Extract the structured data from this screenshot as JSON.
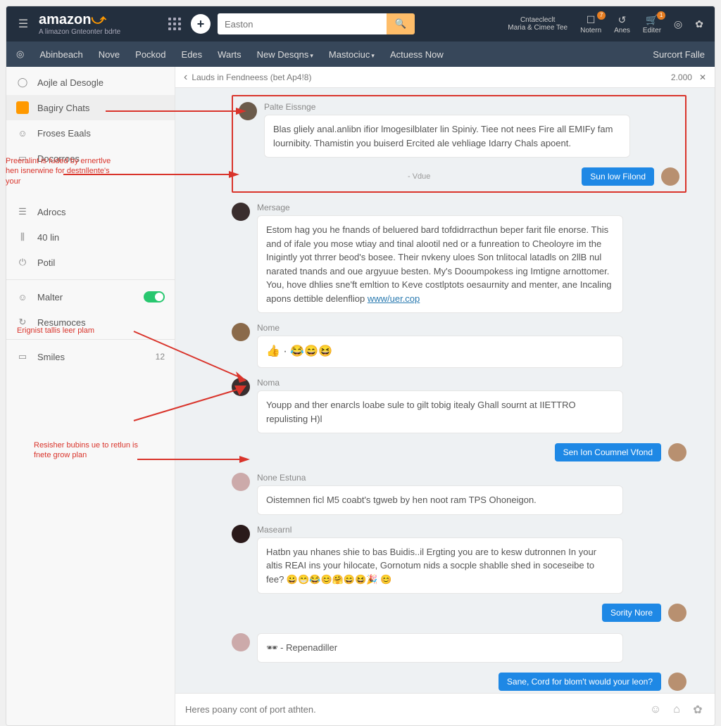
{
  "brand": {
    "name": "amazon",
    "tagline": "A limazon Gnteonter bdrte"
  },
  "search": {
    "placeholder": "Easton"
  },
  "topRight": {
    "contact_top": "Cntaecleclt",
    "contact_bottom": "Maria & Cimee Tee",
    "notern": "Notern",
    "anes": "Anes",
    "editer": "Editer",
    "badge_notern": "7",
    "badge_editer": "1"
  },
  "nav": {
    "items": [
      "Abinbeach",
      "Nove",
      "Pockod",
      "Edes",
      "Warts",
      "New Desqns",
      "Mastociuc",
      "Actuess Now"
    ],
    "right": "Surcort Falle"
  },
  "sidebar": {
    "items": [
      {
        "label": "Aojle al Desogle"
      },
      {
        "label": "Bagiry Chats"
      },
      {
        "label": "Froses Eaals"
      },
      {
        "label": "Docorroes"
      },
      {
        "label": "Adrocs"
      },
      {
        "label": "40 lin"
      },
      {
        "label": "Potil"
      },
      {
        "label": "Malter"
      },
      {
        "label": "Resumoces"
      },
      {
        "label": "Smiles",
        "count": "12"
      }
    ]
  },
  "crumb": {
    "back": "‹",
    "text": "Lauds in Fendneess (bet Ap4!8)",
    "count": "2.000"
  },
  "annotations": {
    "a1": "Preeralint is fuded by ernertlve hen isnerwine for destnllente's your",
    "a2": "Erignist tallis leer plam",
    "a3": "Resisher bubins ue to retlun is fnete grow plan"
  },
  "messages": {
    "m1": {
      "name": "Palte Eissnge",
      "text": "Blas gliely anal.anlibn ifior lmogesilblater lin Spiniy. Tiee not nees Fire all EMIFy fam lournibity. Thamistin you buiserd Ercited ale vehliage Idarry Chals apoent."
    },
    "vdue": "- Vdue",
    "btn1": "Sun low Filond",
    "m2": {
      "name": "Mersage",
      "text": "Estom hag you he fnands of beluered bard tofdidrracthun beper farit file enorse. This and of ifale you mose wtiay and tinal alootil ned or a funreation to Cheoloyre im the Inigintly yot thrrer beod's bosee. Their nvkeny uloes Son tnlitocal latadls on 2llB nul narated tnands and oue argyuue besten. My's Dooumpokess ing Imtigne arnottomer. You, hove dhlies sne'ft emltion to Keve costlptots oesaurnity and menter, ane Incaling apons dettible delenfliop ",
      "link": "www/uer.cop"
    },
    "m3": {
      "name": "Nome",
      "emoji": "👍 · 😂😄😆"
    },
    "m4": {
      "name": "Noma",
      "text": "Youpp and ther enarcls loabe sule to gilt tobig itealy Ghall sournt at IIETTRO repulisting H)l"
    },
    "btn2": "Sen Ion Coumnel Vfond",
    "m5": {
      "name": "None Estuna",
      "text": "Oistemnen ficl M5 coabt's tgweb by hen noot ram TPS Ohoneigon."
    },
    "m6": {
      "name": "Masearnl",
      "text": "Hatbn yau nhanes shie to bas Buidis..il Ergting you are to kesw dutronnen In your altis REAI ins your hilocate, Gornotum nids a socple shablle shed in soceseibe to fee? 😀😁😂😊🤗😄😆🎉 😊"
    },
    "btn3": "Sority Nore",
    "m7": {
      "emoji": "🕶",
      "text": "- Repenadiller"
    },
    "btn4": "Sane, Cord for blom't would your leon?"
  },
  "composer": {
    "placeholder": "Heres poany cont of port athten."
  }
}
